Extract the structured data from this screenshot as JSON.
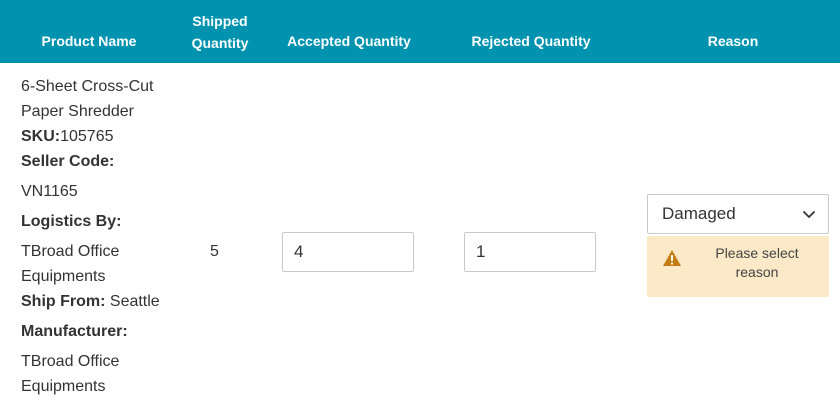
{
  "table": {
    "headers": {
      "product_name": "Product Name",
      "shipped_line1": "Shipped",
      "shipped_line2": "Quantity",
      "accepted_quantity": "Accepted Quantity",
      "rejected_quantity": "Rejected Quantity",
      "reason": "Reason"
    },
    "row": {
      "product_name_line1": "6-Sheet Cross-Cut",
      "product_name_line2": "Paper Shredder",
      "sku_label": "SKU:",
      "sku_value": "105765",
      "seller_code_label": "Seller Code:",
      "seller_code_value": "VN1165",
      "logistics_label": "Logistics By:",
      "logistics_line1": "TBroad Office",
      "logistics_line2": "Equipments",
      "ship_from_label": "Ship From:",
      "ship_from_value": "Seattle",
      "manufacturer_label": "Manufacturer:",
      "manufacturer_line1": "TBroad Office",
      "manufacturer_line2": "Equipments",
      "shipped_quantity": "5",
      "accepted_quantity": "4",
      "rejected_quantity": "1",
      "reason_selected": "Damaged",
      "warning_line1": "Please select",
      "warning_line2": "reason"
    }
  },
  "icons": {
    "dropdown": "chevron-down-icon",
    "warning": "warning-triangle-icon"
  },
  "colors": {
    "header_bg": "#0093b0",
    "warning_bg": "#fbe9c8",
    "warning_icon": "#c67c13"
  }
}
